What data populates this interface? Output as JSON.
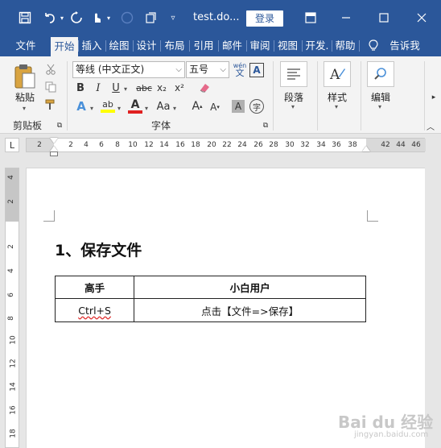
{
  "window": {
    "doc_title": "test.do...",
    "login_label": "登录"
  },
  "tabs": [
    "文件",
    "开始",
    "插入",
    "绘图",
    "设计",
    "布局",
    "引用",
    "邮件",
    "审阅",
    "视图",
    "开发.",
    "帮助",
    "告诉我"
  ],
  "active_tab": "开始",
  "ribbon": {
    "clipboard": {
      "paste_label": "粘贴",
      "group_label": "剪贴板"
    },
    "font": {
      "font_name": "等线 (中文正文)",
      "font_size": "五号",
      "group_label": "字体",
      "bold": "B",
      "italic": "I",
      "underline": "U",
      "strike": "abc",
      "subscript": "x₂",
      "superscript": "x²",
      "effects": "A",
      "highlight": "ab",
      "color": "A",
      "case": "Aa",
      "grow": "A",
      "shrink": "A",
      "char_shade": "A",
      "enclose": "字",
      "wen": "wén",
      "wen_char": "文"
    },
    "paragraph": {
      "label": "段落"
    },
    "styles": {
      "label": "样式"
    },
    "editing": {
      "label": "编辑"
    }
  },
  "ruler": {
    "tab_marker": "L",
    "numbers": [
      "2",
      "2",
      "4",
      "6",
      "8",
      "10",
      "12",
      "14",
      "16",
      "18",
      "20",
      "22",
      "24",
      "26",
      "28",
      "30",
      "32",
      "34",
      "36",
      "38",
      "42",
      "44",
      "46"
    ],
    "vnumbers": [
      "4",
      "2",
      "2",
      "4",
      "6",
      "8",
      "10",
      "12",
      "14",
      "16",
      "18"
    ]
  },
  "document": {
    "heading": "1、保存文件",
    "table": {
      "headers": [
        "高手",
        "小白用户"
      ],
      "rows": [
        [
          "Ctrl+S",
          "点击【文件=>保存】"
        ]
      ]
    }
  },
  "watermark": {
    "main": "Bai du 经验",
    "sub": "jingyan.baidu.com"
  },
  "colors": {
    "accent": "#2b579a",
    "ribbon_bg": "#f3f3f3",
    "highlight_yellow": "#ffff00",
    "font_red": "#e02020"
  },
  "icons": [
    "save-icon",
    "undo-icon",
    "redo-icon",
    "touch-mode-icon",
    "autosave-icon",
    "share-icon",
    "customize-icon",
    "ribbon-display-icon",
    "minimize-icon",
    "restore-icon",
    "close-icon",
    "lightbulb-icon",
    "paste-icon",
    "cut-icon",
    "copy-icon",
    "format-painter-icon",
    "clear-format-icon",
    "paragraph-icon",
    "styles-icon",
    "search-icon"
  ]
}
